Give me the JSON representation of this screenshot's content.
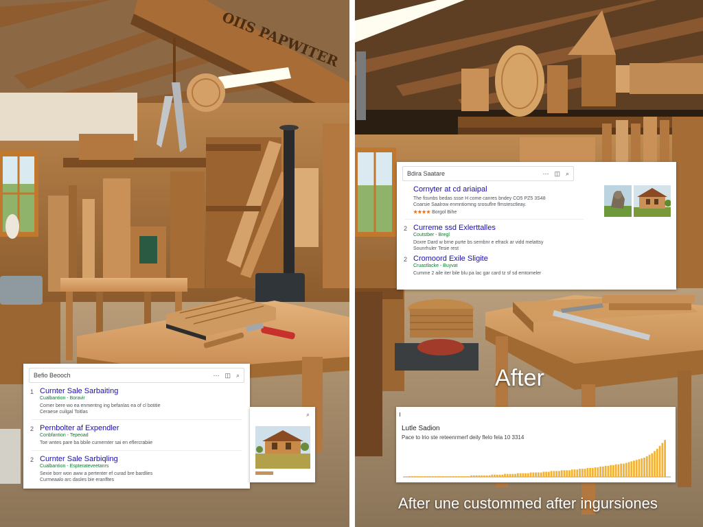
{
  "left": {
    "sign_text": "OIIS PAPWITER",
    "search_panel": {
      "query": "Befio Beooch",
      "icons": [
        "more-icon",
        "camera-icon",
        "search-icon"
      ],
      "results": [
        {
          "number": "1",
          "title": "Curnter Sale Sarbaiting",
          "url": "Cualbantion - Boravir",
          "snippet": [
            "Comer bere wo ea enmentng ing befanlas ea of cl botitie",
            "Ceraese cuilgal Toitlas"
          ]
        },
        {
          "number": "2",
          "title": "Pernbolter af Expendler",
          "url": "Conbfantion - Tepeoad",
          "snippet": [
            "Toe wntes pare ba bbile curnemter sai en eflercrabiie"
          ]
        },
        {
          "number": "2",
          "title": "Curnter Sale Sarbiqling",
          "url": "Cualbantion - Espterateveetanrs",
          "snippet": [
            "Sexie borr won aww a pertenter ef curad bre bardlies",
            "Curmeaalo arc dasles bie eranfltes"
          ]
        }
      ]
    },
    "image_panel": {
      "icons": [
        "search-icon"
      ]
    }
  },
  "right": {
    "search_panel": {
      "query": "Bdira Saatare",
      "icons": [
        "more-icon",
        "camera-icon",
        "search-icon"
      ],
      "results": [
        {
          "number": "",
          "title": "Cornyter at cd ariaipal",
          "url": "",
          "snippet": [
            "The fisvnbs bedas ssse H come canres bndey CO5 PZ5 3S48",
            "Coarsie Saalrow enmntiomng srosuflre flmstesctleay."
          ],
          "stars": "★★★★",
          "stars_label": "Borgol Bihe"
        },
        {
          "number": "2",
          "title": "Curreme ssd Exlerttalles",
          "url": "Coutstber - Bregl",
          "snippet": [
            "Doxre Dard w brne purte bs sernbnr e efrack ar vidd melattsy",
            "Sounrhuler Tesie rest"
          ]
        },
        {
          "number": "2",
          "title": "Cromoord Exile Sligite",
          "url": "Cruastlacke - Buyvat",
          "snippet": [
            "Cumme 2 aile iter bile blu pa lac gar card tz sf sd emtomeler"
          ]
        }
      ]
    },
    "after_label": "After",
    "chart_panel": {
      "title": "Lutle Sadion",
      "subtitle": "Pace to lrio ste reteenrmerf deily flelo fela 10 3314",
      "bar_color": "#f2b234"
    },
    "bottom_caption": "After une custommed after ingursiones"
  },
  "chart_data": {
    "type": "bar",
    "title": "Lutle Sadion",
    "subtitle": "Pace to lrio ste reteenrmerf deily flelo fela 10 3314",
    "values": [
      1,
      1,
      1,
      1,
      1,
      1,
      1,
      1,
      1,
      1,
      1,
      1,
      1,
      1,
      1,
      1,
      1,
      1,
      1,
      1,
      1,
      1,
      1,
      1,
      2,
      2,
      2,
      2,
      2,
      2,
      2,
      2,
      3,
      3,
      3,
      3,
      3,
      4,
      4,
      4,
      4,
      4,
      5,
      5,
      5,
      5,
      5,
      6,
      6,
      6,
      6,
      6,
      7,
      7,
      7,
      8,
      8,
      8,
      8,
      9,
      9,
      9,
      9,
      10,
      10,
      10,
      11,
      11,
      11,
      12,
      12,
      12,
      13,
      13,
      14,
      14,
      15,
      15,
      16,
      16,
      17,
      17,
      18,
      18,
      19,
      20,
      21,
      22,
      23,
      24,
      25,
      26,
      28,
      30,
      32,
      35,
      38,
      42,
      46,
      50
    ],
    "ylim": [
      0,
      52
    ],
    "grid": false
  }
}
